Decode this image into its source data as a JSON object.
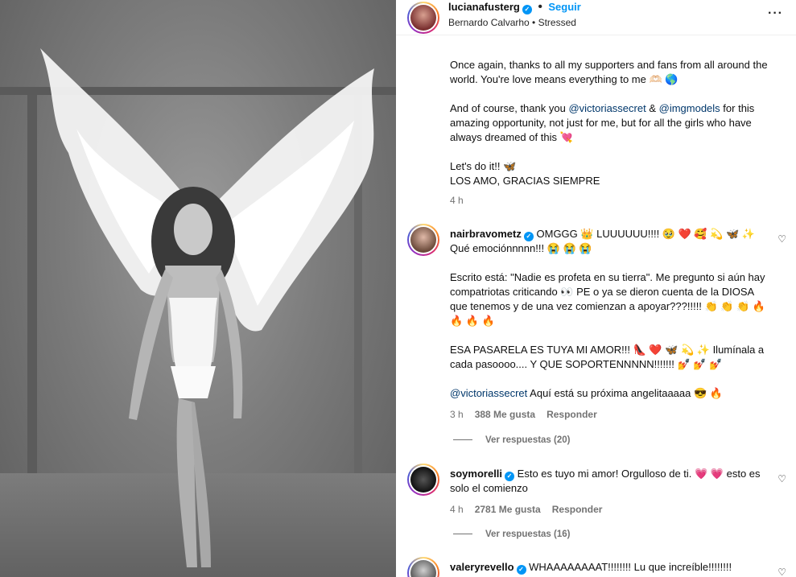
{
  "post": {
    "author": "lucianafusterg",
    "follow_label": "Seguir",
    "audio": "Bernardo Calvarho • Stressed",
    "caption": {
      "p1": "Once again, thanks to all my supporters and fans from all around the world. You're love means everything to me 🫶🏻 🌎",
      "p2_a": "And of course, thank you ",
      "p2_m1": "@victoriassecret",
      "p2_b": " & ",
      "p2_m2": "@imgmodels",
      "p2_c": " for this amazing opportunity, not just for me, but for all the girls who have always dreamed of this 💘",
      "p3_l1": "Let's do it!! 🦋",
      "p3_l2": "LOS AMO, GRACIAS SIEMPRE",
      "time": "4 h"
    }
  },
  "comments": [
    {
      "user": "nairbravometz",
      "l1": "OMGGG 👑 LUUUUUU!!!! 🥹 ❤️ 🥰 💫 🦋 ✨",
      "l2": "Qué emociónnnnn!!! 😭 😭 😭",
      "p2": "Escrito está: \"Nadie es profeta en su tierra\". Me pregunto si aún hay compatriotas criticando 👀 PE o ya se dieron cuenta de la DIOSA que tenemos y de una vez comienzan a apoyar???!!!!! 👏 👏 👏 🔥 🔥 🔥 🔥",
      "p3": "ESA PASARELA ES TUYA MI AMOR!!! 👠 ❤️ 🦋 💫 ✨ Ilumínala a cada pasoooo.... Y QUE SOPORTENNNNN!!!!!!! 💅 💅 💅",
      "p4_m": "@victoriassecret",
      "p4_t": " Aquí está su próxima angelitaaaaa 😎 🔥",
      "time": "3 h",
      "likes": "388 Me gusta",
      "reply": "Responder",
      "view_replies": "Ver respuestas (20)"
    },
    {
      "user": "soymorelli",
      "text": "Esto es tuyo mi amor! Orgulloso de ti. 💗 💗 esto es solo el comienzo",
      "time": "4 h",
      "likes": "2781 Me gusta",
      "reply": "Responder",
      "view_replies": "Ver respuestas (16)"
    },
    {
      "user": "valeryrevello",
      "text": "WHAAAAAAAAT!!!!!!!! Lu que increíble!!!!!!!!"
    }
  ],
  "colors": {
    "accent": "#0095f6",
    "mention": "#00376b",
    "muted": "#737373"
  }
}
